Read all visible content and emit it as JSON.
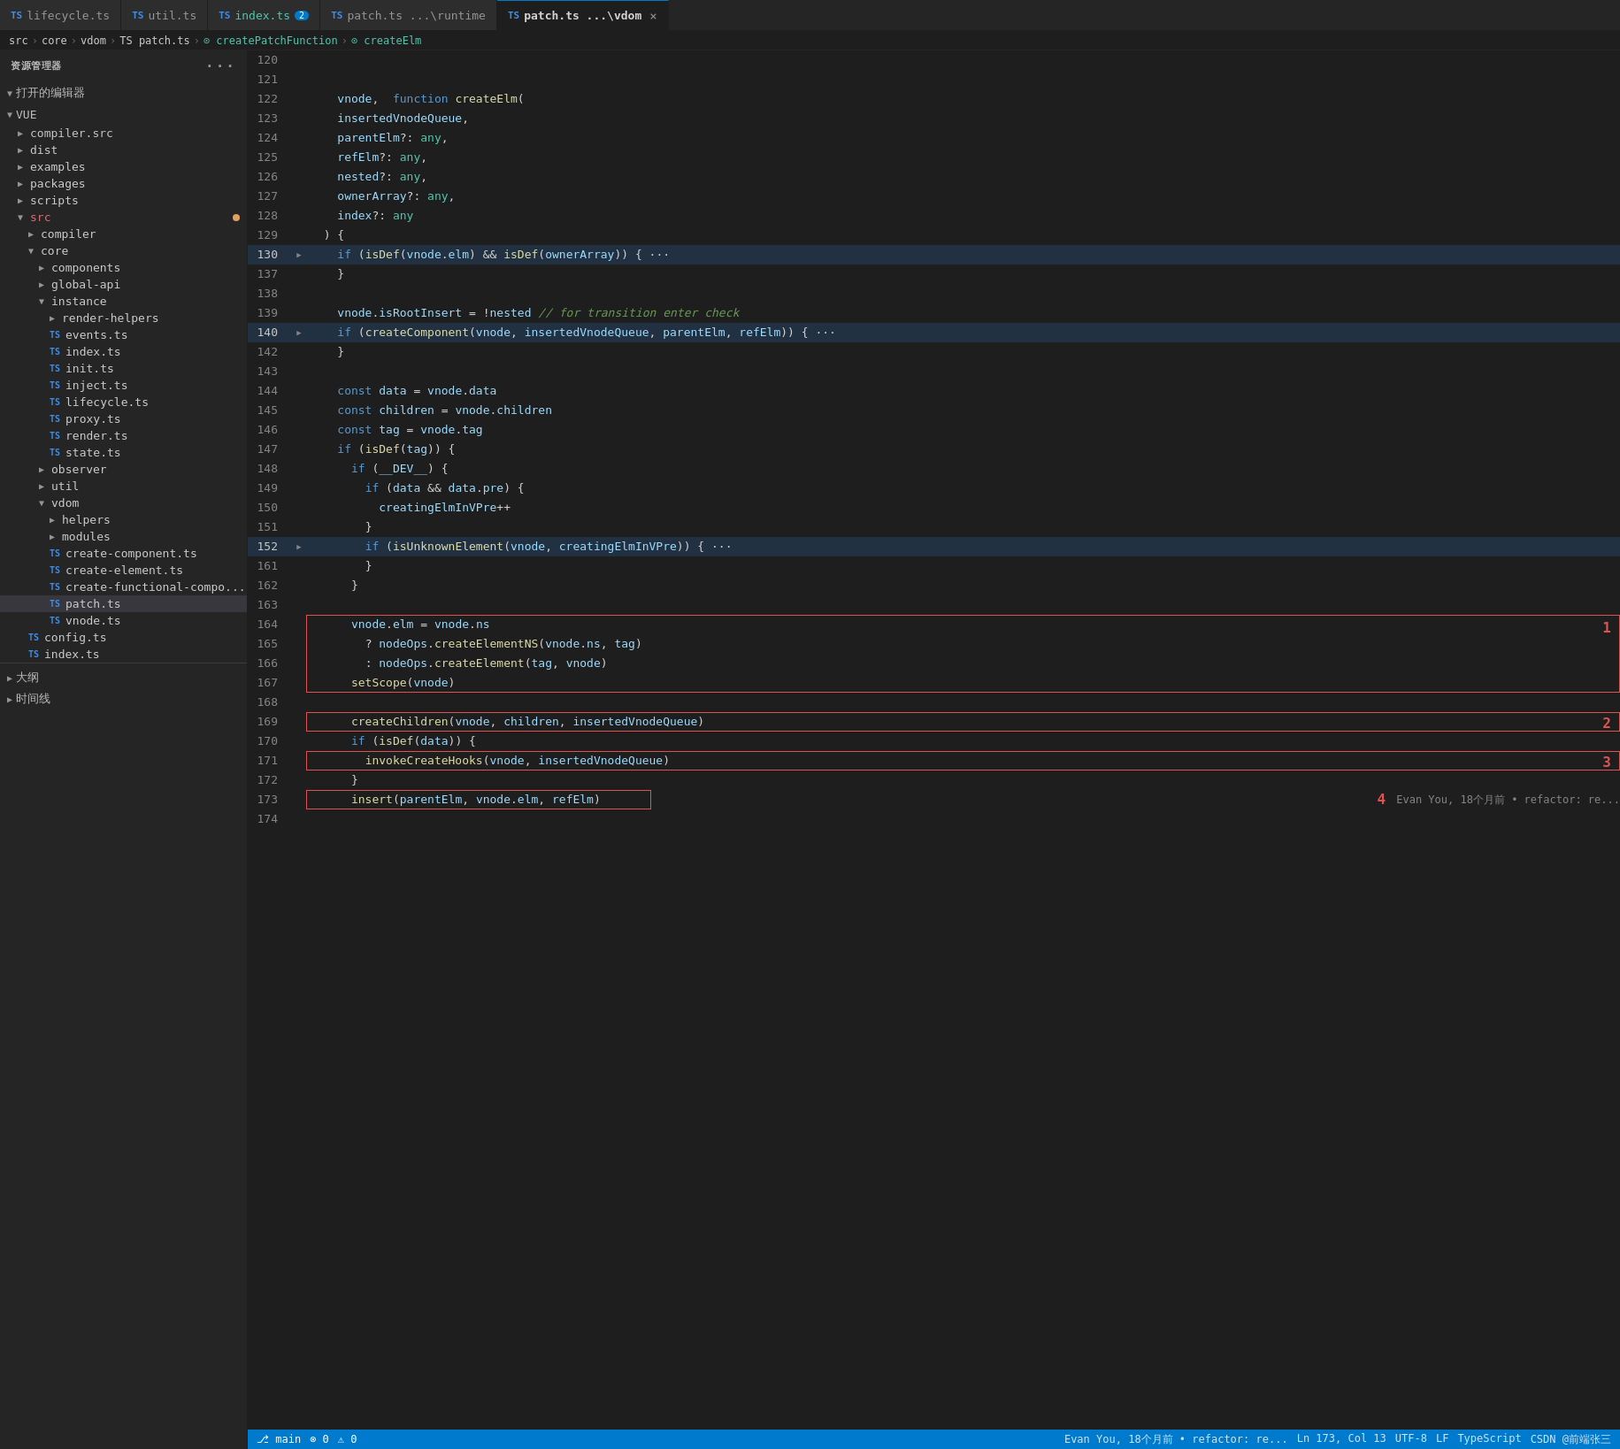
{
  "tabs": [
    {
      "id": "lifecycle",
      "icon": "TS",
      "label": "lifecycle.ts",
      "active": false,
      "modified": false,
      "badge": null,
      "closeable": false
    },
    {
      "id": "util",
      "icon": "TS",
      "label": "util.ts",
      "active": false,
      "modified": false,
      "badge": null,
      "closeable": false
    },
    {
      "id": "index",
      "icon": "TS",
      "label": "index.ts",
      "active": false,
      "modified": false,
      "badge": "2",
      "closeable": false
    },
    {
      "id": "patch-runtime",
      "icon": "TS",
      "label": "patch.ts ...\\runtime",
      "active": false,
      "modified": false,
      "badge": null,
      "closeable": false
    },
    {
      "id": "patch-vdom",
      "icon": "TS",
      "label": "patch.ts ...\\vdom",
      "active": true,
      "modified": false,
      "badge": null,
      "closeable": true
    }
  ],
  "breadcrumb": {
    "parts": [
      "src",
      "core",
      "vdom",
      "TS patch.ts",
      "createPatchFunction",
      "createElm"
    ]
  },
  "sidebar": {
    "title": "资源管理器",
    "sections": {
      "open_editors": "打开的编辑器",
      "vue": "VUE"
    },
    "tree": [
      {
        "label": "compiler.src",
        "level": 1,
        "type": "folder",
        "collapsed": true
      },
      {
        "label": "dist",
        "level": 1,
        "type": "folder",
        "collapsed": true
      },
      {
        "label": "examples",
        "level": 1,
        "type": "folder",
        "collapsed": true
      },
      {
        "label": "packages",
        "level": 1,
        "type": "folder",
        "collapsed": true
      },
      {
        "label": "scripts",
        "level": 1,
        "type": "folder",
        "collapsed": true
      },
      {
        "label": "src",
        "level": 1,
        "type": "folder",
        "collapsed": false,
        "modified": true
      },
      {
        "label": "compiler",
        "level": 2,
        "type": "folder",
        "collapsed": true
      },
      {
        "label": "core",
        "level": 2,
        "type": "folder",
        "collapsed": false
      },
      {
        "label": "components",
        "level": 3,
        "type": "folder",
        "collapsed": true
      },
      {
        "label": "global-api",
        "level": 3,
        "type": "folder",
        "collapsed": true
      },
      {
        "label": "instance",
        "level": 3,
        "type": "folder",
        "collapsed": false
      },
      {
        "label": "render-helpers",
        "level": 4,
        "type": "folder",
        "collapsed": true
      },
      {
        "label": "events.ts",
        "level": 4,
        "type": "ts"
      },
      {
        "label": "index.ts",
        "level": 4,
        "type": "ts"
      },
      {
        "label": "init.ts",
        "level": 4,
        "type": "ts"
      },
      {
        "label": "inject.ts",
        "level": 4,
        "type": "ts"
      },
      {
        "label": "lifecycle.ts",
        "level": 4,
        "type": "ts"
      },
      {
        "label": "proxy.ts",
        "level": 4,
        "type": "ts"
      },
      {
        "label": "render.ts",
        "level": 4,
        "type": "ts"
      },
      {
        "label": "state.ts",
        "level": 4,
        "type": "ts"
      },
      {
        "label": "observer",
        "level": 3,
        "type": "folder",
        "collapsed": true
      },
      {
        "label": "util",
        "level": 3,
        "type": "folder",
        "collapsed": true
      },
      {
        "label": "vdom",
        "level": 3,
        "type": "folder",
        "collapsed": false
      },
      {
        "label": "helpers",
        "level": 4,
        "type": "folder",
        "collapsed": true
      },
      {
        "label": "modules",
        "level": 4,
        "type": "folder",
        "collapsed": true
      },
      {
        "label": "create-component.ts",
        "level": 4,
        "type": "ts"
      },
      {
        "label": "create-element.ts",
        "level": 4,
        "type": "ts"
      },
      {
        "label": "create-functional-compo...",
        "level": 4,
        "type": "ts"
      },
      {
        "label": "patch.ts",
        "level": 4,
        "type": "ts",
        "selected": true
      },
      {
        "label": "vnode.ts",
        "level": 4,
        "type": "ts"
      }
    ],
    "bottom": [
      {
        "label": "config.ts",
        "level": 2,
        "type": "ts"
      },
      {
        "label": "index.ts",
        "level": 2,
        "type": "ts"
      }
    ],
    "outline_label": "大纲",
    "timeline_label": "时间线"
  },
  "code": {
    "lines": [
      {
        "num": 120,
        "content": "",
        "highlight": false
      },
      {
        "num": 121,
        "content": "  function createElm(",
        "highlight": false
      },
      {
        "num": 122,
        "content": "    vnode,",
        "highlight": false
      },
      {
        "num": 123,
        "content": "    insertedVnodeQueue,",
        "highlight": false
      },
      {
        "num": 124,
        "content": "    parentElm?: any,",
        "highlight": false
      },
      {
        "num": 125,
        "content": "    refElm?: any,",
        "highlight": false
      },
      {
        "num": 126,
        "content": "    nested?: any,",
        "highlight": false
      },
      {
        "num": 127,
        "content": "    ownerArray?: any,",
        "highlight": false
      },
      {
        "num": 128,
        "content": "    index?: any",
        "highlight": false
      },
      {
        "num": 129,
        "content": "  ) {",
        "highlight": false
      },
      {
        "num": 130,
        "content": "    if (isDef(vnode.elm) && isDef(ownerArray)) { ···",
        "highlight": true,
        "fold": true
      },
      {
        "num": 137,
        "content": "    }",
        "highlight": false
      },
      {
        "num": 138,
        "content": "",
        "highlight": false
      },
      {
        "num": 139,
        "content": "    vnode.isRootInsert = !nested // for transition enter check",
        "highlight": false
      },
      {
        "num": 140,
        "content": "    if (createComponent(vnode, insertedVnodeQueue, parentElm, refElm)) { ···",
        "highlight": true,
        "fold": true
      },
      {
        "num": 142,
        "content": "    }",
        "highlight": false
      },
      {
        "num": 143,
        "content": "",
        "highlight": false
      },
      {
        "num": 144,
        "content": "    const data = vnode.data",
        "highlight": false
      },
      {
        "num": 145,
        "content": "    const children = vnode.children",
        "highlight": false
      },
      {
        "num": 146,
        "content": "    const tag = vnode.tag",
        "highlight": false
      },
      {
        "num": 147,
        "content": "    if (isDef(tag)) {",
        "highlight": false
      },
      {
        "num": 148,
        "content": "      if (__DEV__) {",
        "highlight": false
      },
      {
        "num": 149,
        "content": "        if (data && data.pre) {",
        "highlight": false
      },
      {
        "num": 150,
        "content": "          creatingElmInVPre++",
        "highlight": false
      },
      {
        "num": 151,
        "content": "        }",
        "highlight": false
      },
      {
        "num": 152,
        "content": "        if (isUnknownElement(vnode, creatingElmInVPre)) { ···",
        "highlight": true,
        "fold": true
      },
      {
        "num": 161,
        "content": "        }",
        "highlight": false
      },
      {
        "num": 162,
        "content": "      }",
        "highlight": false
      },
      {
        "num": 163,
        "content": "",
        "highlight": false
      },
      {
        "num": 164,
        "content": "      vnode.elm = vnode.ns",
        "highlight": false,
        "box_start": true
      },
      {
        "num": 165,
        "content": "        ? nodeOps.createElementNS(vnode.ns, tag)",
        "highlight": false
      },
      {
        "num": 166,
        "content": "        : nodeOps.createElement(tag, vnode)",
        "highlight": false
      },
      {
        "num": 167,
        "content": "      setScope(vnode)",
        "highlight": false,
        "box_end": true,
        "anno": "1"
      },
      {
        "num": 168,
        "content": "",
        "highlight": false
      },
      {
        "num": 169,
        "content": "      createChildren(vnode, children, insertedVnodeQueue)",
        "highlight": false,
        "box_line": true,
        "anno": "2"
      },
      {
        "num": 170,
        "content": "      if (isDef(data)) {",
        "highlight": false
      },
      {
        "num": 171,
        "content": "        invokeCreateHooks(vnode, insertedVnodeQueue)",
        "highlight": false,
        "box_line": true,
        "anno": "3"
      },
      {
        "num": 172,
        "content": "      }",
        "highlight": false
      },
      {
        "num": 173,
        "content": "      insert(parentElm, vnode.elm, refElm)",
        "highlight": false,
        "box_line": true,
        "anno": "4"
      },
      {
        "num": 174,
        "content": "",
        "highlight": false
      }
    ]
  },
  "status": {
    "git": "main",
    "errors": "0",
    "warnings": "0",
    "file_info": "Evan You, 18个月前 • refactor: re...",
    "encoding": "UTF-8",
    "line_ending": "LF",
    "language": "TypeScript",
    "line_col": "Ln 173, Col 13"
  }
}
